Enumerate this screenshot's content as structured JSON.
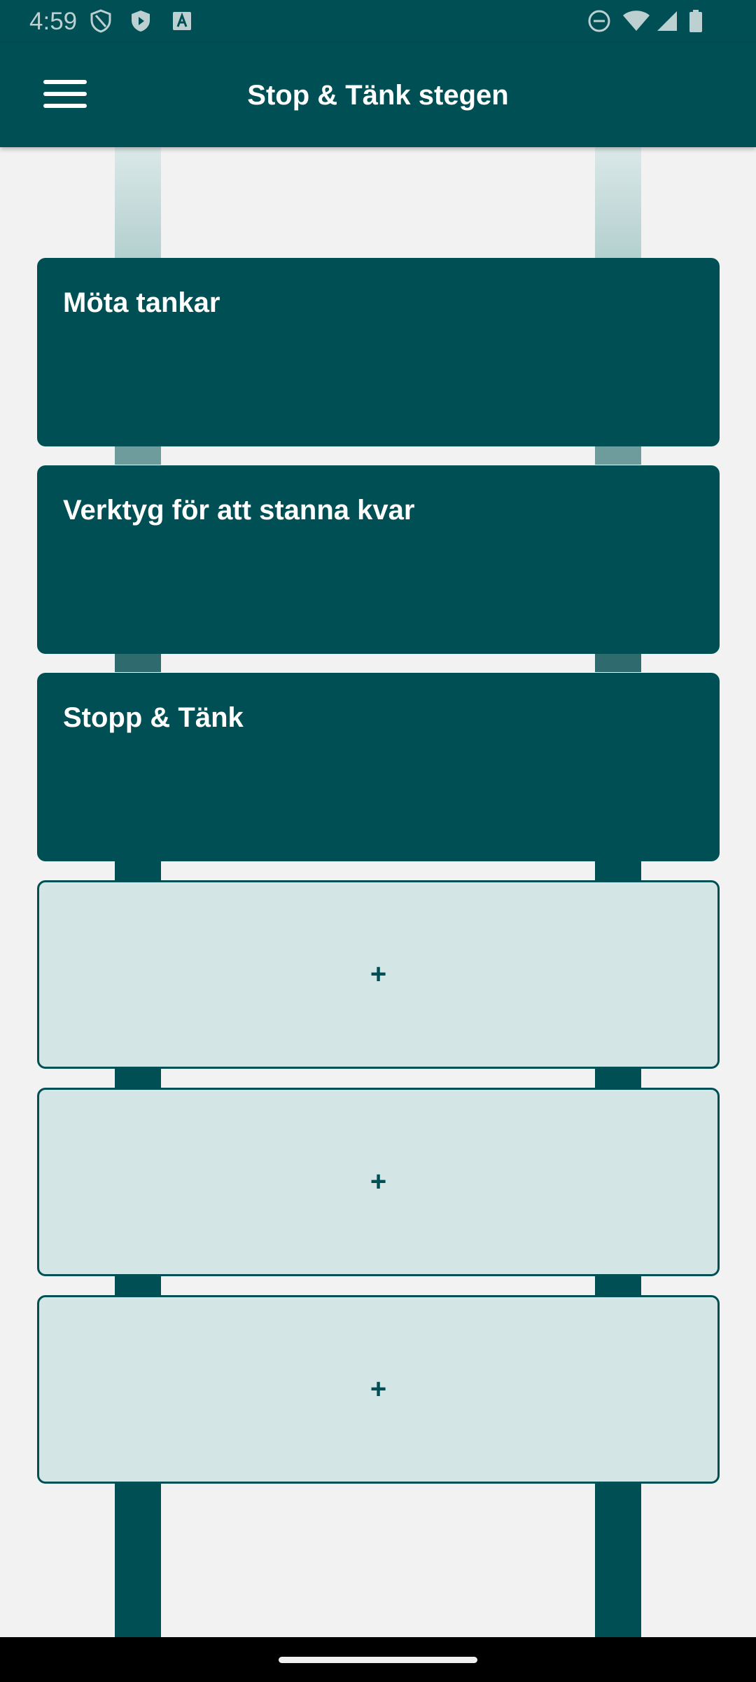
{
  "status_bar": {
    "time": "4:59",
    "left_icons": [
      "shield-icon",
      "play-shield-icon",
      "font-a-icon"
    ],
    "right_icons": [
      "do-not-disturb-icon",
      "wifi-icon",
      "signal-icon",
      "battery-icon"
    ]
  },
  "app_bar": {
    "title": "Stop & Tänk stegen",
    "menu_icon": "hamburger-menu-icon"
  },
  "colors": {
    "primary": "#004f54",
    "empty_step_fill": "#d3e5e4",
    "background": "#f2f2f2"
  },
  "steps": [
    {
      "title": "Möta tankar",
      "filled": true
    },
    {
      "title": "Verktyg för att stanna kvar",
      "filled": true
    },
    {
      "title": "Stopp & Tänk",
      "filled": true
    },
    {
      "label": "+",
      "filled": false
    },
    {
      "label": "+",
      "filled": false
    },
    {
      "label": "+",
      "filled": false
    }
  ]
}
